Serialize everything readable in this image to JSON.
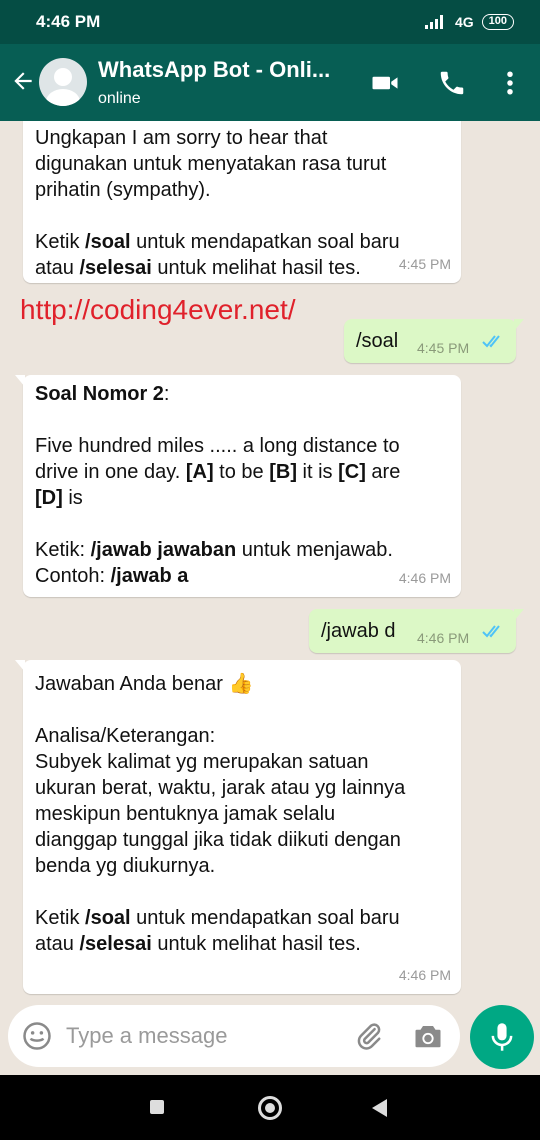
{
  "status_bar": {
    "time": "4:46 PM",
    "network": "4G",
    "battery": "100"
  },
  "header": {
    "title": "WhatsApp Bot - Onli...",
    "subtitle": "online"
  },
  "watermark": "http://coding4ever.net/",
  "messages": [
    {
      "lines": [
        [
          {
            "t": "Ungkapan I am sorry to hear that"
          }
        ],
        [
          {
            "t": "digunakan untuk menyatakan rasa turut"
          }
        ],
        [
          {
            "t": "prihatin (sympathy)."
          }
        ],
        [
          {
            "t": ""
          }
        ],
        [
          {
            "t": "Ketik "
          },
          {
            "t": "/soal",
            "b": true
          },
          {
            "t": " untuk mendapatkan soal baru"
          }
        ],
        [
          {
            "t": "atau "
          },
          {
            "t": "/selesai",
            "b": true
          },
          {
            "t": " untuk melihat hasil tes."
          }
        ]
      ],
      "time": "4:45 PM"
    },
    {
      "text": "/soal",
      "time": "4:45 PM"
    },
    {
      "lines": [
        [
          {
            "t": "Soal Nomor 2",
            "b": true
          },
          {
            "t": ":"
          }
        ],
        [
          {
            "t": ""
          }
        ],
        [
          {
            "t": "Five hundred miles ..... a long distance to"
          }
        ],
        [
          {
            "t": "drive in one day. "
          },
          {
            "t": "[A]",
            "b": true
          },
          {
            "t": " to be "
          },
          {
            "t": "[B]",
            "b": true
          },
          {
            "t": " it is "
          },
          {
            "t": "[C]",
            "b": true
          },
          {
            "t": " are"
          }
        ],
        [
          {
            "t": "[D]",
            "b": true
          },
          {
            "t": " is"
          }
        ],
        [
          {
            "t": ""
          }
        ],
        [
          {
            "t": "Ketik: "
          },
          {
            "t": "/jawab jawaban",
            "b": true
          },
          {
            "t": " untuk menjawab."
          }
        ],
        [
          {
            "t": "Contoh: "
          },
          {
            "t": "/jawab a",
            "b": true
          }
        ]
      ],
      "time": "4:46 PM"
    },
    {
      "text": "/jawab d",
      "time": "4:46 PM"
    },
    {
      "lines": [
        [
          {
            "t": "Jawaban Anda benar 👍"
          }
        ],
        [
          {
            "t": ""
          }
        ],
        [
          {
            "t": "Analisa/Keterangan:"
          }
        ],
        [
          {
            "t": "Subyek kalimat yg merupakan satuan"
          }
        ],
        [
          {
            "t": "ukuran berat, waktu, jarak atau yg lainnya"
          }
        ],
        [
          {
            "t": "meskipun bentuknya jamak selalu"
          }
        ],
        [
          {
            "t": "dianggap tunggal jika tidak diikuti dengan"
          }
        ],
        [
          {
            "t": "benda yg diukurnya."
          }
        ],
        [
          {
            "t": ""
          }
        ],
        [
          {
            "t": "Ketik "
          },
          {
            "t": "/soal",
            "b": true
          },
          {
            "t": " untuk mendapatkan soal baru"
          }
        ],
        [
          {
            "t": "atau "
          },
          {
            "t": "/selesai",
            "b": true
          },
          {
            "t": " untuk melihat hasil tes."
          }
        ]
      ],
      "time": "4:46 PM"
    }
  ],
  "input": {
    "placeholder": "Type a message"
  },
  "colors": {
    "header": "#075e54",
    "status_bar": "#054d44",
    "accent": "#00a884",
    "outgoing_bubble": "#dcf8c6",
    "read_ticks": "#4fc3f7",
    "watermark": "#e0212b"
  }
}
